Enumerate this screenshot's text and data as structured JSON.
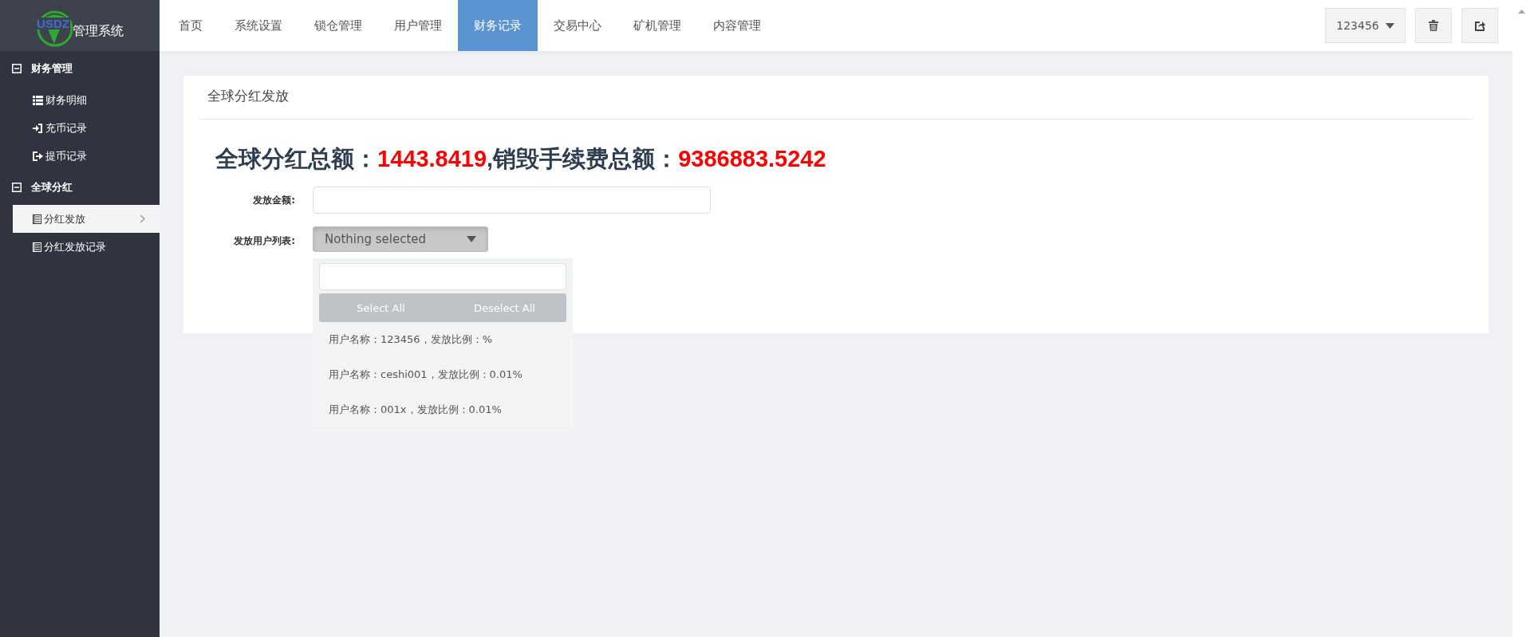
{
  "brand": {
    "logo_text": "USDZ",
    "title": "管理系统"
  },
  "nav": [
    {
      "label": "首页",
      "selected": false
    },
    {
      "label": "系统设置",
      "selected": false
    },
    {
      "label": "锁仓管理",
      "selected": false
    },
    {
      "label": "用户管理",
      "selected": false
    },
    {
      "label": "财务记录",
      "selected": true
    },
    {
      "label": "交易中心",
      "selected": false
    },
    {
      "label": "矿机管理",
      "selected": false
    },
    {
      "label": "内容管理",
      "selected": false
    }
  ],
  "user_menu": {
    "label": "123456"
  },
  "sidebar": [
    {
      "label": "财务管理",
      "expanded": true,
      "items": [
        {
          "label": "财务明细",
          "selected": false
        },
        {
          "label": "充币记录",
          "selected": false
        },
        {
          "label": "提币记录",
          "selected": false
        }
      ]
    },
    {
      "label": "全球分红",
      "expanded": true,
      "items": [
        {
          "label": "分红发放",
          "selected": true
        },
        {
          "label": "分红发放记录",
          "selected": false
        }
      ]
    }
  ],
  "card": {
    "title": "全球分红发放",
    "summary": [
      {
        "kind": "label",
        "text": "全球分红总额："
      },
      {
        "kind": "value",
        "text": "1443.8419"
      },
      {
        "kind": "label",
        "text": ",销毁手续费总额："
      },
      {
        "kind": "value",
        "text": "9386883.5242"
      }
    ],
    "amount_field": {
      "label": "发放金额:"
    },
    "user_select": {
      "label": "发放用户列表:",
      "placeholder": "Nothing selected",
      "expanded": true,
      "select_all": "Select All",
      "deselect_all": "Deselect All",
      "options": [
        {
          "label": "用户名称：123456，发放比例：%",
          "selected": false
        },
        {
          "label": "用户名称：ceshi001，发放比例：0.01%",
          "selected": false
        },
        {
          "label": "用户名称：001x，发放比例：0.01%",
          "selected": false
        }
      ]
    }
  }
}
